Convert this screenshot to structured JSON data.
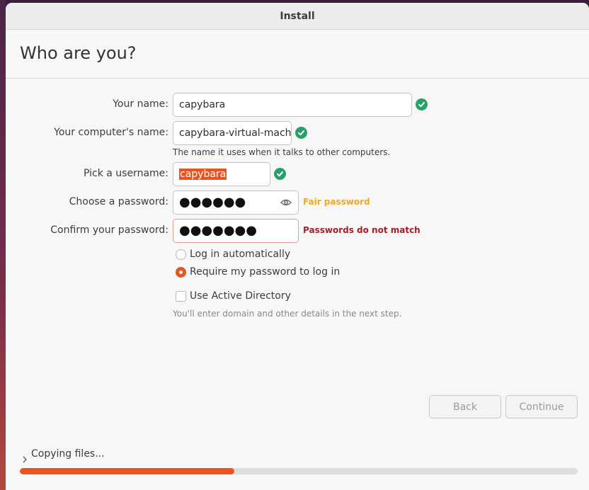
{
  "window": {
    "title": "Install"
  },
  "page": {
    "heading": "Who are you?"
  },
  "form": {
    "name_label": "Your name:",
    "name_value": "capybara",
    "computer_label": "Your computer's name:",
    "computer_value": "capybara-virtual-machi",
    "computer_hint": "The name it uses when it talks to other computers.",
    "username_label": "Pick a username:",
    "username_value": "capybara",
    "password_label": "Choose a password:",
    "password_value": "●●●●●●",
    "password_strength": "Fair password",
    "confirm_label": "Confirm your password:",
    "confirm_value": "●●●●●●●",
    "confirm_error": "Passwords do not match",
    "login_auto_label": "Log in automatically",
    "login_require_label": "Require my password to log in",
    "login_selected": "require",
    "active_directory_label": "Use Active Directory",
    "active_directory_checked": false,
    "active_directory_hint": "You'll enter domain and other details in the next step."
  },
  "buttons": {
    "back": "Back",
    "continue": "Continue"
  },
  "progress": {
    "label": "Copying files...",
    "fraction": 0.385
  },
  "colors": {
    "accent": "#e95420",
    "valid": "#26a269",
    "warning": "#f5a623",
    "error": "#a51d2d"
  },
  "icons": {
    "valid": "check-circle-icon",
    "reveal": "eye-icon",
    "expander": "chevron-right-icon"
  }
}
